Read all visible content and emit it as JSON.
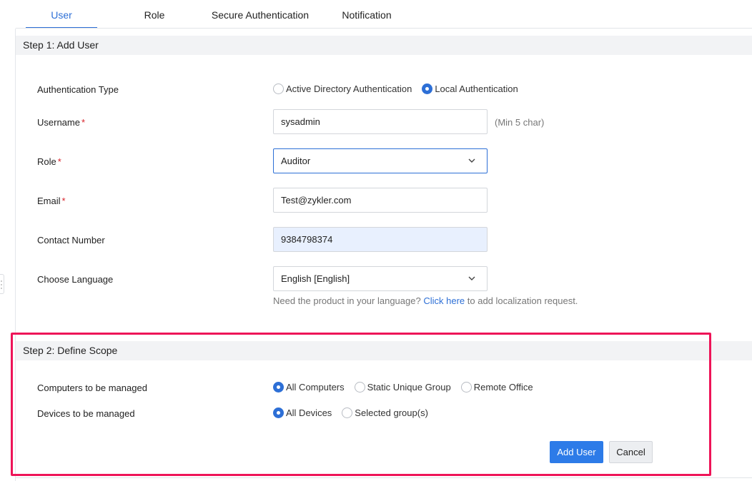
{
  "tabs": [
    {
      "label": "User",
      "active": true
    },
    {
      "label": "Role",
      "active": false
    },
    {
      "label": "Secure Authentication",
      "active": false
    },
    {
      "label": "Notification",
      "active": false
    }
  ],
  "step1": {
    "title": "Step 1: Add User",
    "auth_type": {
      "label": "Authentication Type",
      "options": [
        {
          "label": "Active Directory Authentication",
          "checked": false
        },
        {
          "label": "Local Authentication",
          "checked": true
        }
      ]
    },
    "username": {
      "label": "Username",
      "required_mark": "*",
      "value": "sysadmin",
      "hint": "(Min 5 char)"
    },
    "role": {
      "label": "Role",
      "required_mark": "*",
      "value": "Auditor"
    },
    "email": {
      "label": "Email",
      "required_mark": "*",
      "value": "Test@zykler.com"
    },
    "contact": {
      "label": "Contact Number",
      "value": "9384798374"
    },
    "language": {
      "label": "Choose Language",
      "value": "English [English]",
      "help_prefix": "Need the product in your language?",
      "help_link": "Click here",
      "help_suffix": "to add localization request."
    }
  },
  "step2": {
    "title": "Step 2: Define Scope",
    "computers": {
      "label": "Computers to be managed",
      "options": [
        {
          "label": "All Computers",
          "checked": true
        },
        {
          "label": "Static Unique Group",
          "checked": false
        },
        {
          "label": "Remote Office",
          "checked": false
        }
      ]
    },
    "devices": {
      "label": "Devices to be managed",
      "options": [
        {
          "label": "All Devices",
          "checked": true
        },
        {
          "label": "Selected group(s)",
          "checked": false
        }
      ]
    }
  },
  "actions": {
    "add_label": "Add User",
    "cancel_label": "Cancel"
  },
  "colors": {
    "accent": "#2d6fd6",
    "required": "#d8232a",
    "highlight_border": "#ee1458",
    "autofill_bg": "#e8f0fe"
  }
}
